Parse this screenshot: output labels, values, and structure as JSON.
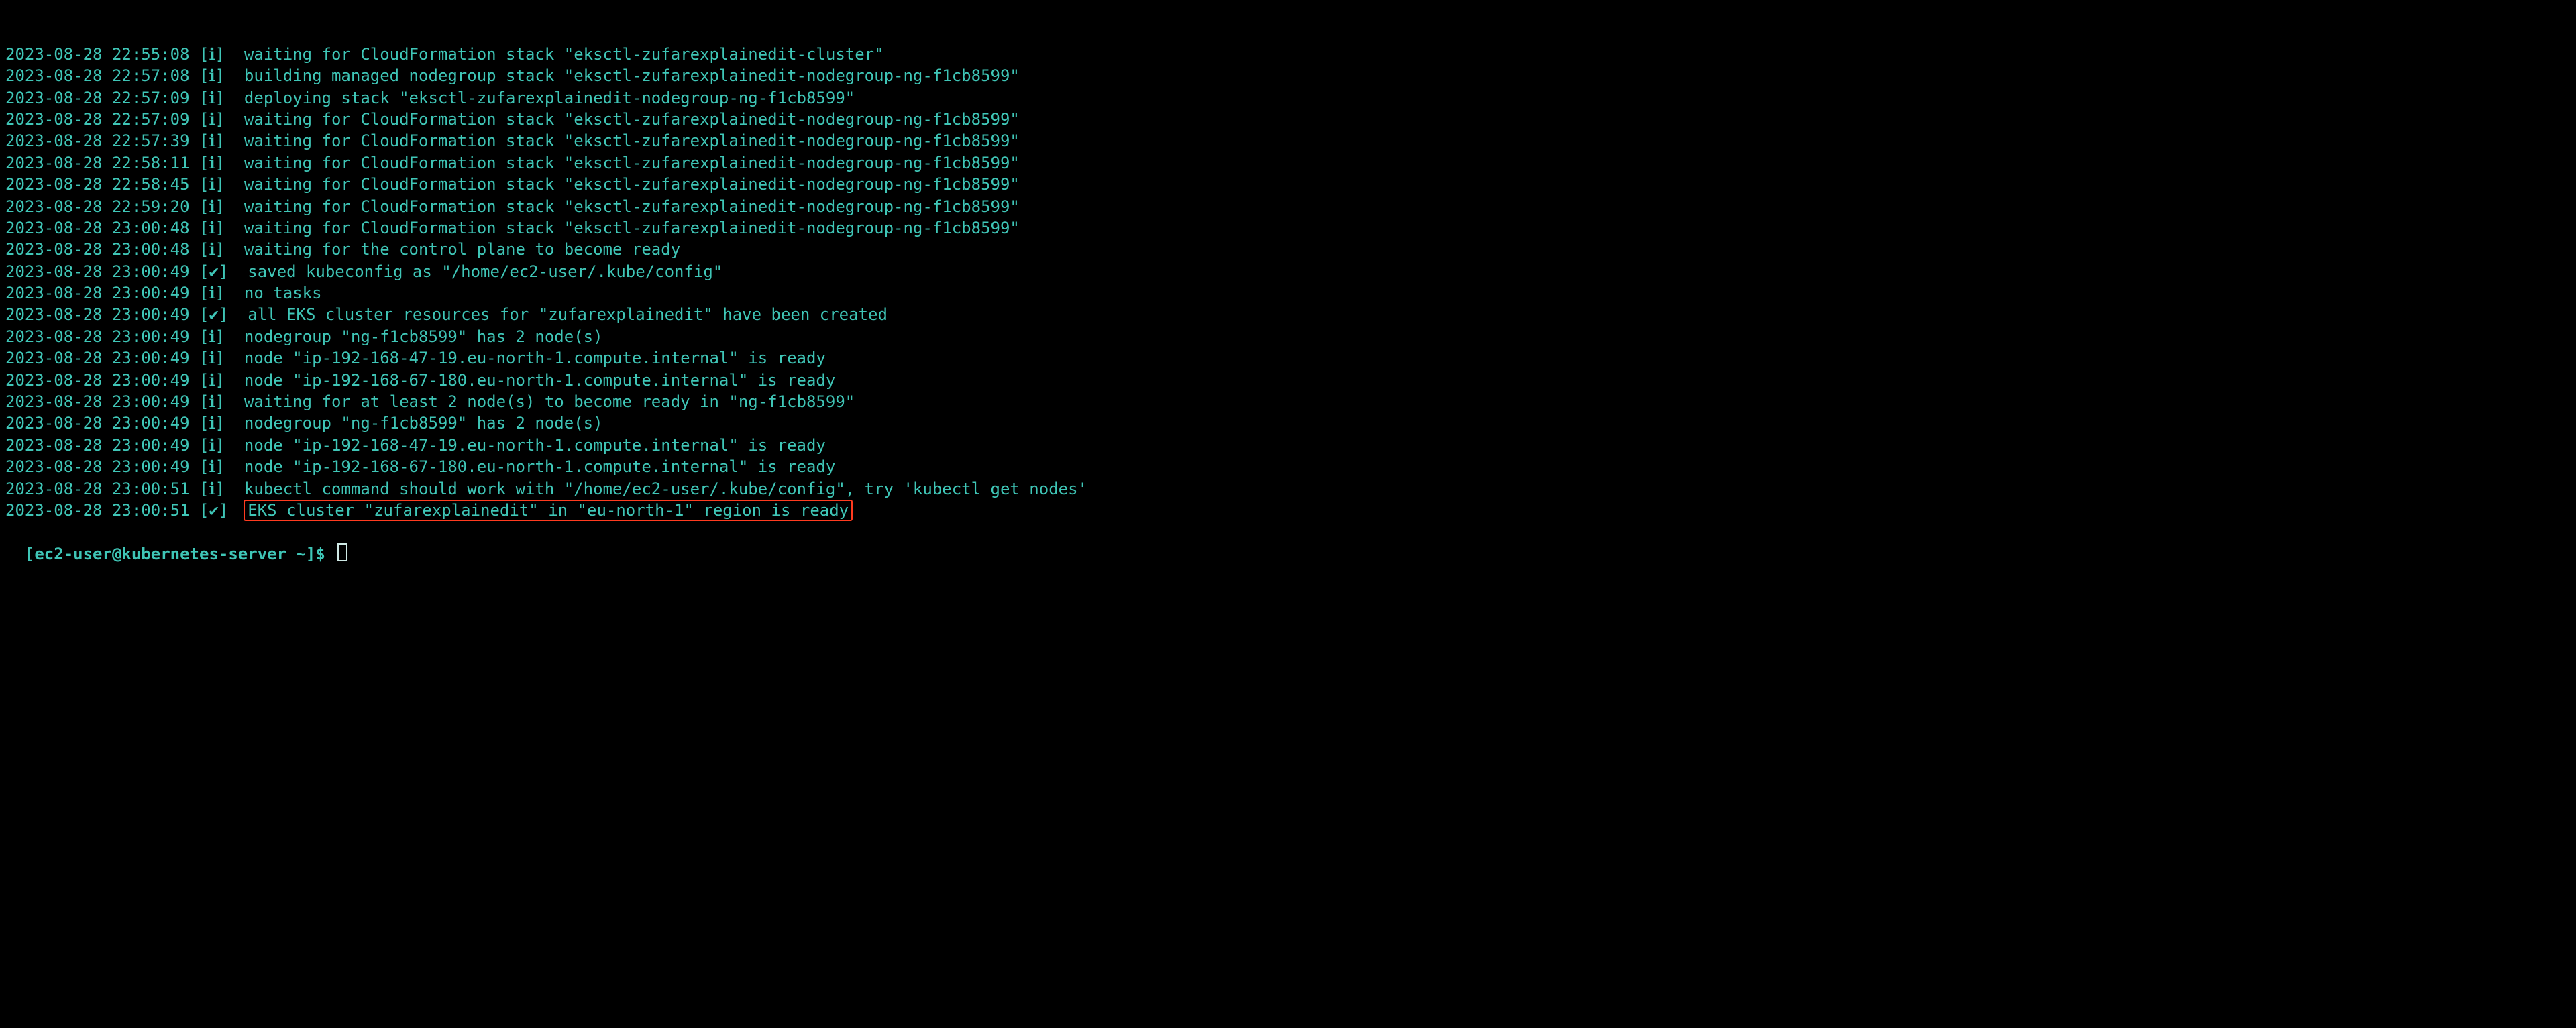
{
  "colors": {
    "background": "#000000",
    "text": "#3fc6b7",
    "highlight_border": "#ff3b1f"
  },
  "log_lines": [
    {
      "ts": "2023-08-28 22:55:08",
      "lvl": "[ℹ]",
      "msg": "waiting for CloudFormation stack \"eksctl-zufarexplainedit-cluster\"",
      "highlight": false
    },
    {
      "ts": "2023-08-28 22:57:08",
      "lvl": "[ℹ]",
      "msg": "building managed nodegroup stack \"eksctl-zufarexplainedit-nodegroup-ng-f1cb8599\"",
      "highlight": false
    },
    {
      "ts": "2023-08-28 22:57:09",
      "lvl": "[ℹ]",
      "msg": "deploying stack \"eksctl-zufarexplainedit-nodegroup-ng-f1cb8599\"",
      "highlight": false
    },
    {
      "ts": "2023-08-28 22:57:09",
      "lvl": "[ℹ]",
      "msg": "waiting for CloudFormation stack \"eksctl-zufarexplainedit-nodegroup-ng-f1cb8599\"",
      "highlight": false
    },
    {
      "ts": "2023-08-28 22:57:39",
      "lvl": "[ℹ]",
      "msg": "waiting for CloudFormation stack \"eksctl-zufarexplainedit-nodegroup-ng-f1cb8599\"",
      "highlight": false
    },
    {
      "ts": "2023-08-28 22:58:11",
      "lvl": "[ℹ]",
      "msg": "waiting for CloudFormation stack \"eksctl-zufarexplainedit-nodegroup-ng-f1cb8599\"",
      "highlight": false
    },
    {
      "ts": "2023-08-28 22:58:45",
      "lvl": "[ℹ]",
      "msg": "waiting for CloudFormation stack \"eksctl-zufarexplainedit-nodegroup-ng-f1cb8599\"",
      "highlight": false
    },
    {
      "ts": "2023-08-28 22:59:20",
      "lvl": "[ℹ]",
      "msg": "waiting for CloudFormation stack \"eksctl-zufarexplainedit-nodegroup-ng-f1cb8599\"",
      "highlight": false
    },
    {
      "ts": "2023-08-28 23:00:48",
      "lvl": "[ℹ]",
      "msg": "waiting for CloudFormation stack \"eksctl-zufarexplainedit-nodegroup-ng-f1cb8599\"",
      "highlight": false
    },
    {
      "ts": "2023-08-28 23:00:48",
      "lvl": "[ℹ]",
      "msg": "waiting for the control plane to become ready",
      "highlight": false
    },
    {
      "ts": "2023-08-28 23:00:49",
      "lvl": "[✔]",
      "msg": "saved kubeconfig as \"/home/ec2-user/.kube/config\"",
      "highlight": false
    },
    {
      "ts": "2023-08-28 23:00:49",
      "lvl": "[ℹ]",
      "msg": "no tasks",
      "highlight": false
    },
    {
      "ts": "2023-08-28 23:00:49",
      "lvl": "[✔]",
      "msg": "all EKS cluster resources for \"zufarexplainedit\" have been created",
      "highlight": false
    },
    {
      "ts": "2023-08-28 23:00:49",
      "lvl": "[ℹ]",
      "msg": "nodegroup \"ng-f1cb8599\" has 2 node(s)",
      "highlight": false
    },
    {
      "ts": "2023-08-28 23:00:49",
      "lvl": "[ℹ]",
      "msg": "node \"ip-192-168-47-19.eu-north-1.compute.internal\" is ready",
      "highlight": false
    },
    {
      "ts": "2023-08-28 23:00:49",
      "lvl": "[ℹ]",
      "msg": "node \"ip-192-168-67-180.eu-north-1.compute.internal\" is ready",
      "highlight": false
    },
    {
      "ts": "2023-08-28 23:00:49",
      "lvl": "[ℹ]",
      "msg": "waiting for at least 2 node(s) to become ready in \"ng-f1cb8599\"",
      "highlight": false
    },
    {
      "ts": "2023-08-28 23:00:49",
      "lvl": "[ℹ]",
      "msg": "nodegroup \"ng-f1cb8599\" has 2 node(s)",
      "highlight": false
    },
    {
      "ts": "2023-08-28 23:00:49",
      "lvl": "[ℹ]",
      "msg": "node \"ip-192-168-47-19.eu-north-1.compute.internal\" is ready",
      "highlight": false
    },
    {
      "ts": "2023-08-28 23:00:49",
      "lvl": "[ℹ]",
      "msg": "node \"ip-192-168-67-180.eu-north-1.compute.internal\" is ready",
      "highlight": false
    },
    {
      "ts": "2023-08-28 23:00:51",
      "lvl": "[ℹ]",
      "msg": "kubectl command should work with \"/home/ec2-user/.kube/config\", try 'kubectl get nodes'",
      "highlight": false
    },
    {
      "ts": "2023-08-28 23:00:51",
      "lvl": "[✔]",
      "msg": "EKS cluster \"zufarexplainedit\" in \"eu-north-1\" region is ready",
      "highlight": true
    }
  ],
  "prompt": "[ec2-user@kubernetes-server ~]$ "
}
